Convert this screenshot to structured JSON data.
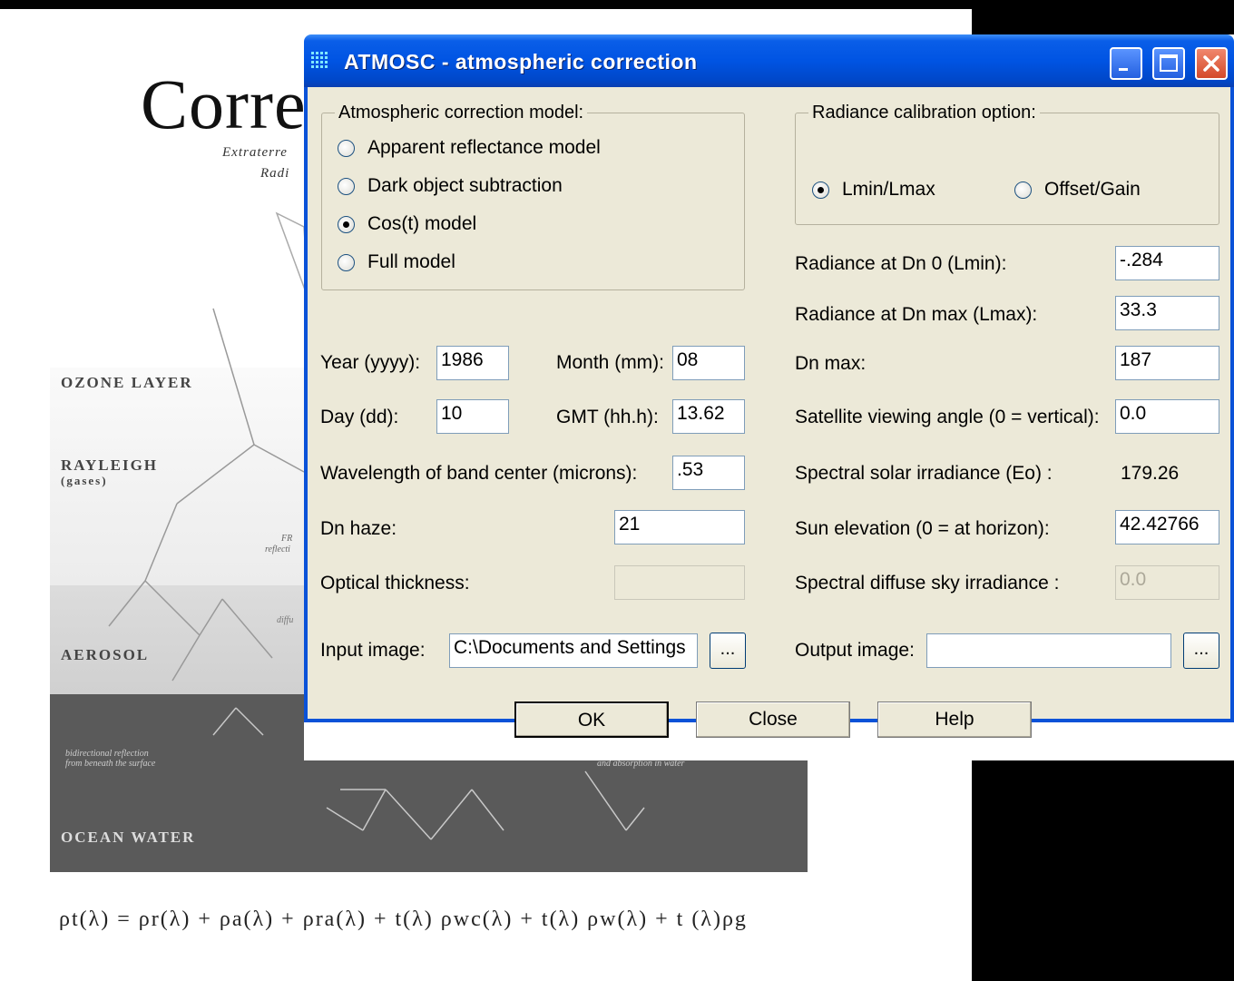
{
  "background_doc": {
    "title": "Corre",
    "subtitle_1": "Extraterre",
    "subtitle_2": "Radi",
    "layers": {
      "ozone": "OZONE LAYER",
      "rayleigh": "RAYLEIGH",
      "rayleigh_sub": "(gases)",
      "aerosol": "AEROSOL",
      "ocean": "OCEAN WATER"
    },
    "notes": {
      "fresnel": "FR",
      "fresnel_2": "reflecti",
      "diffuse": "diffu",
      "bidirectional": "bidirectional reflection",
      "bidirectional_2": "from beneath the surface",
      "absorption": "and absorption in water"
    },
    "equation": "ρt(λ) = ρr(λ) + ρa(λ) + ρra(λ) + t(λ) ρwc(λ) + t(λ) ρw(λ) + t (λ)ρg"
  },
  "window": {
    "title": "ATMOSC - atmospheric correction",
    "controls": {
      "minimize": "minimize-icon",
      "maximize": "maximize-icon",
      "close": "close-icon"
    }
  },
  "model_group": {
    "legend": "Atmospheric correction model:",
    "options": [
      {
        "label": "Apparent reflectance model",
        "selected": false
      },
      {
        "label": "Dark object subtraction",
        "selected": false
      },
      {
        "label": "Cos(t) model",
        "selected": true
      },
      {
        "label": "Full model",
        "selected": false
      }
    ]
  },
  "calibration_group": {
    "legend": "Radiance calibration option:",
    "options": [
      {
        "label": "Lmin/Lmax",
        "selected": true
      },
      {
        "label": "Offset/Gain",
        "selected": false
      }
    ]
  },
  "left_fields": {
    "year_label": "Year (yyyy):",
    "year_value": "1986",
    "month_label": "Month (mm):",
    "month_value": "08",
    "day_label": "Day (dd):",
    "day_value": "10",
    "gmt_label": "GMT (hh.h):",
    "gmt_value": "13.62",
    "wavelength_label": "Wavelength of band center (microns):",
    "wavelength_value": ".53",
    "dn_haze_label": "Dn haze:",
    "dn_haze_value": "21",
    "optical_label": "Optical thickness:",
    "optical_value": "",
    "input_label": "Input image:",
    "input_value": "C:\\Documents and Settings",
    "browse": "..."
  },
  "right_fields": {
    "lmin_label": "Radiance at Dn 0 (Lmin):",
    "lmin_value": "-.284",
    "lmax_label": "Radiance at Dn max (Lmax):",
    "lmax_value": "33.3",
    "dnmax_label": "Dn max:",
    "dnmax_value": "187",
    "viewing_label": "Satellite viewing angle (0 = vertical):",
    "viewing_value": "0.0",
    "eo_label": "Spectral solar irradiance (Eo) :",
    "eo_value": "179.26",
    "sun_label": "Sun elevation (0 = at horizon):",
    "sun_value": "42.42766",
    "diffuse_label": "Spectral diffuse sky irradiance :",
    "diffuse_value": "0.0",
    "output_label": "Output image:",
    "output_value": "",
    "browse": "..."
  },
  "buttons": {
    "ok": "OK",
    "close": "Close",
    "help": "Help"
  },
  "colors": {
    "title_bar": "#0054e3",
    "dialog_face": "#ece9d8",
    "close_button": "#d44a2a"
  }
}
